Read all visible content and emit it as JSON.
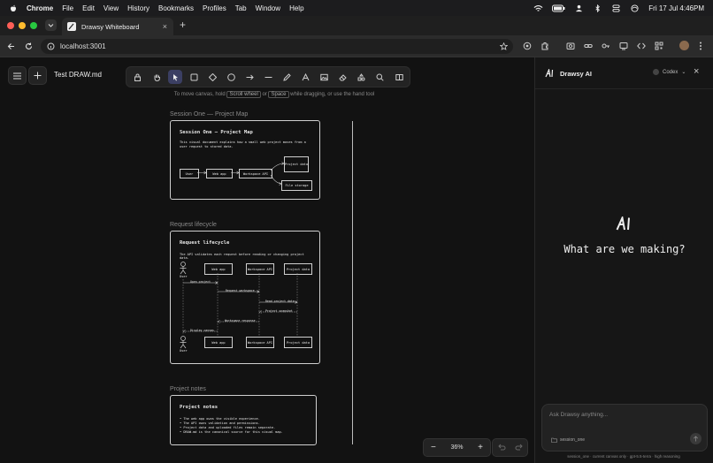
{
  "menubar": {
    "app": "Chrome",
    "items": [
      "File",
      "Edit",
      "View",
      "History",
      "Bookmarks",
      "Profiles",
      "Tab",
      "Window",
      "Help"
    ],
    "datetime": "Fri 17 Jul  4:46PM"
  },
  "browser": {
    "tab_title": "Drawsy Whiteboard",
    "url": "localhost:3001"
  },
  "app": {
    "file_name": "Test DRAW.md",
    "hint": {
      "prefix": "To move canvas, hold",
      "key1": "Scroll wheel",
      "or": "or",
      "key2": "Space",
      "suffix": "while dragging, or use the hand tool"
    },
    "zoom": "36%"
  },
  "frames": {
    "project_map": {
      "label": "Session One — Project Map",
      "title": "Session One — Project Map",
      "desc": "This visual document explains how a small web project moves from a user request to stored data.",
      "nodes": [
        "User",
        "Web app",
        "Workspace API",
        "Project data",
        "File storage"
      ]
    },
    "lifecycle": {
      "label": "Request lifecycle",
      "title": "Request lifecycle",
      "desc": "The API validates each request before reading or changing project data.",
      "actor": "User",
      "participants": [
        "Web app",
        "Workspace API",
        "Project data"
      ],
      "messages": [
        "Open project",
        "Request workspace",
        "Read project data",
        "Project snapshot",
        "Workspace response",
        "Display canvas"
      ]
    },
    "notes": {
      "label": "Project notes",
      "title": "Project notes",
      "items": [
        "The web app owns the visible experience.",
        "The API owns validation and permissions.",
        "Project data and uploaded files remain separate.",
        "DRAW.md is the canonical source for this visual map."
      ]
    }
  },
  "ai": {
    "title": "Drawsy AI",
    "model_selector": "Codex",
    "prompt": "What are we making?",
    "input_placeholder": "Ask Drawsy anything...",
    "session": "session_one",
    "footer": "session_one · current canvas only · gpt-5.5-terra · high reasoning"
  }
}
